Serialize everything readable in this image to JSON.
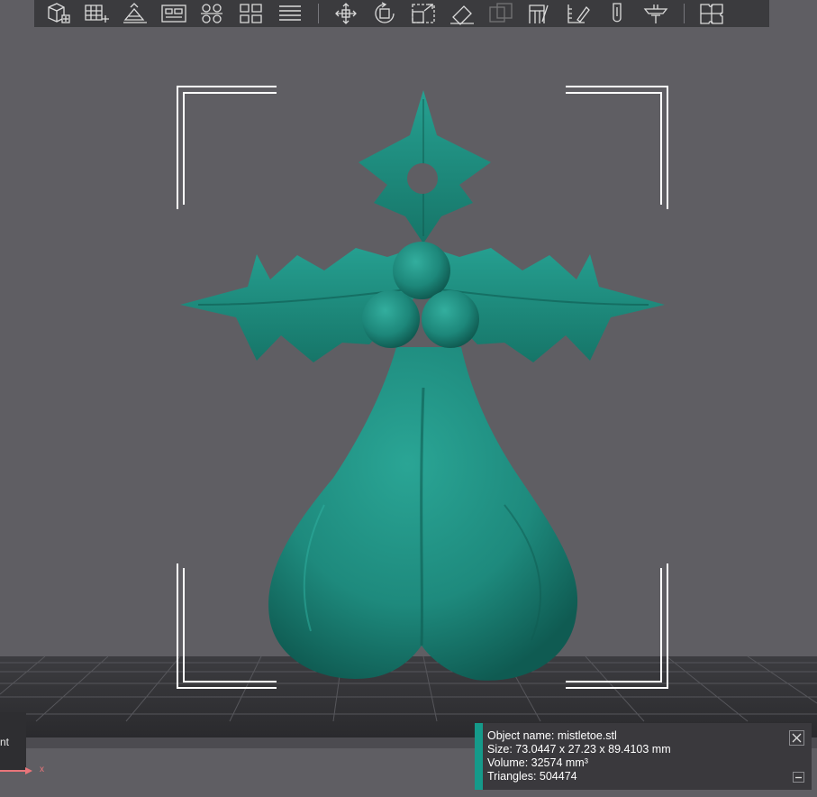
{
  "toolbar": {
    "tools": [
      {
        "icon": "add-object-icon",
        "enabled": true
      },
      {
        "icon": "add-plate-icon",
        "enabled": true
      },
      {
        "icon": "auto-orient-icon",
        "enabled": true
      },
      {
        "icon": "arrange-icon",
        "enabled": true
      },
      {
        "icon": "split-objects-icon",
        "enabled": true
      },
      {
        "icon": "split-parts-icon",
        "enabled": true
      },
      {
        "icon": "layers-icon",
        "enabled": true
      },
      {
        "icon": "move-icon",
        "enabled": true
      },
      {
        "icon": "rotate-icon",
        "enabled": true
      },
      {
        "icon": "scale-icon",
        "enabled": true
      },
      {
        "icon": "lay-on-face-icon",
        "enabled": true
      },
      {
        "icon": "boolean-icon",
        "enabled": false
      },
      {
        "icon": "cut-icon",
        "enabled": true
      },
      {
        "icon": "measure-icon",
        "enabled": true
      },
      {
        "icon": "support-paint-icon",
        "enabled": true
      },
      {
        "icon": "text-emboss-icon",
        "enabled": true
      },
      {
        "icon": "assembly-icon",
        "enabled": true
      }
    ]
  },
  "model": {
    "color": "#1e8a7d",
    "highlight": "#2aa595",
    "shadow": "#0f5b52"
  },
  "left_panel": {
    "label": "nt"
  },
  "axis": {
    "x_label": "x",
    "x_color": "#e8757a"
  },
  "info_panel": {
    "object_name": "Object name: mistletoe.stl",
    "size": "Size: 73.0447 x 27.23 x 89.4103 mm",
    "volume": "Volume: 32574 mm³",
    "triangles": "Triangles: 504474",
    "accent_color": "#159a8a"
  }
}
